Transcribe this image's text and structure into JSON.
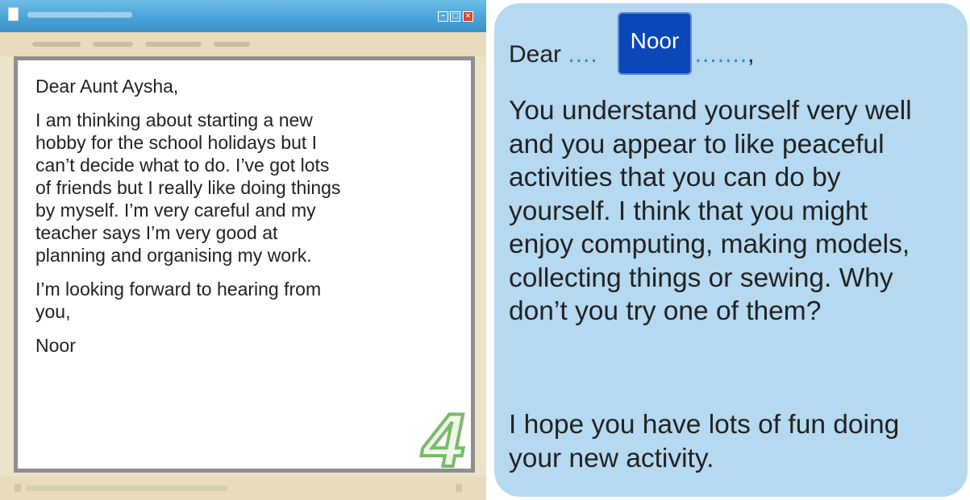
{
  "letter": {
    "greeting": "Dear Aunt Aysha,",
    "body": "I am thinking about starting a new\nhobby for the school holidays but I\ncan’t decide what to do. I’ve got lots\nof friends but I really like doing things\nby myself. I’m very careful and my\nteacher says I’m very good at\nplanning and organising my work.",
    "closing": "I’m looking forward to hearing from\nyou,",
    "signature": "Noor",
    "page_number": "4"
  },
  "reply": {
    "dear_label": "Dear",
    "dots_before": "....",
    "dots_after": "..........",
    "comma": ",",
    "recipient_name": "Noor",
    "body": "You understand yourself very well\nand you appear to like peaceful\nactivities that you can do by\nyourself. I think that you might\nenjoy computing, making models,\ncollecting things or sewing. Why\ndon’t you try one of them?",
    "closing": "I hope you have lots of fun doing\nyour new activity."
  },
  "colors": {
    "title_bar": "#4aa3d8",
    "window_chrome": "#ece4c9",
    "reply_background": "#b5d9f0",
    "name_box": "#0a47b9",
    "page_number_outline": "#7bb96c"
  },
  "icons": {
    "app": "document-icon",
    "minimize": "minimize-icon",
    "maximize": "maximize-icon",
    "close": "close-icon"
  }
}
